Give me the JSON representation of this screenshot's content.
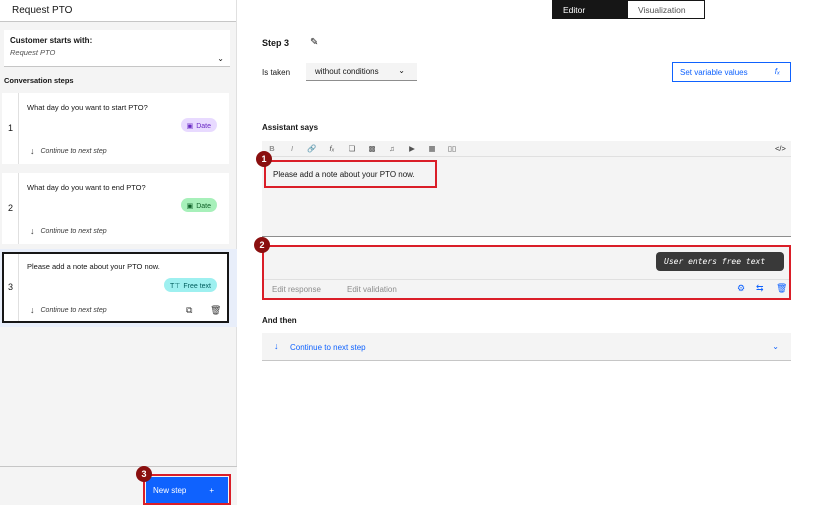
{
  "left": {
    "header": "Request PTO",
    "starts_label": "Customer starts with:",
    "starts_value": "Request PTO",
    "conv_label": "Conversation steps",
    "steps": [
      {
        "num": "1",
        "question": "What day do you want to start PTO?",
        "tag": "Date",
        "cont": "Continue to next step"
      },
      {
        "num": "2",
        "question": "What day do you want to end PTO?",
        "tag": "Date",
        "cont": "Continue to next step"
      },
      {
        "num": "3",
        "question": "Please add a note about your PTO now.",
        "tag": "Free text",
        "cont": "Continue to next step"
      }
    ],
    "new_step": "New step"
  },
  "toggle": {
    "editor": "Editor",
    "visualization": "Visualization"
  },
  "main": {
    "step_title": "Step 3",
    "taken_label": "Is taken",
    "condition": "without conditions",
    "set_variable": "Set variable values",
    "assistant_label": "Assistant says",
    "assistant_text": "Please add a note about your PTO now.",
    "tooltip": "User enters free text",
    "edit_response": "Edit response",
    "edit_validation": "Edit validation",
    "and_then_label": "And then",
    "and_then_value": "Continue to next step"
  },
  "badges": [
    "1",
    "2",
    "3"
  ],
  "colors": {
    "accent": "#0f62fe",
    "highlight": "#da1e28",
    "badge": "#8a0f0f"
  }
}
